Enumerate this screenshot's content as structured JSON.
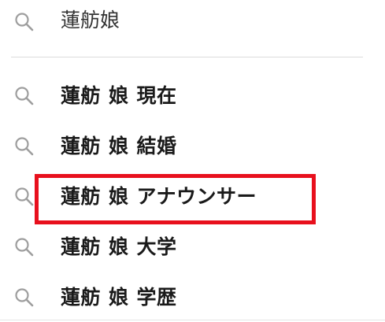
{
  "search": {
    "icon": "search-icon",
    "query": "蓮舫娘"
  },
  "suggestions": [
    {
      "icon": "search-icon",
      "parts": [
        "蓮舫",
        "娘",
        "現在"
      ]
    },
    {
      "icon": "search-icon",
      "parts": [
        "蓮舫",
        "娘",
        "結婚"
      ]
    },
    {
      "icon": "search-icon",
      "parts": [
        "蓮舫",
        "娘",
        "アナウンサー"
      ]
    },
    {
      "icon": "search-icon",
      "parts": [
        "蓮舫",
        "娘",
        "大学"
      ]
    },
    {
      "icon": "search-icon",
      "parts": [
        "蓮舫",
        "娘",
        "学歴"
      ]
    }
  ],
  "highlight": {
    "suggestion_index": 2,
    "color": "#e8101d"
  },
  "colors": {
    "icon": "#9e9e9e",
    "query_text": "#333333",
    "suggestion_text": "#1a1a1a",
    "divider": "#dcdcdc"
  }
}
